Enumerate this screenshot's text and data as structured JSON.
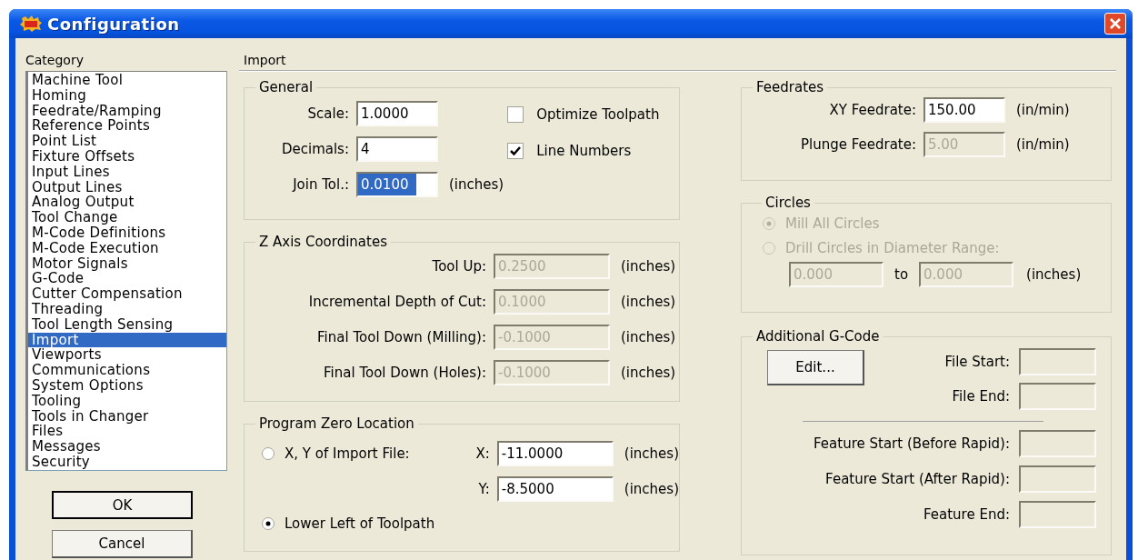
{
  "window": {
    "title": "Configuration"
  },
  "category": {
    "label": "Category",
    "items": [
      {
        "label": "Machine Tool",
        "selected": false
      },
      {
        "label": "Homing",
        "selected": false
      },
      {
        "label": "Feedrate/Ramping",
        "selected": false
      },
      {
        "label": "Reference Points",
        "selected": false
      },
      {
        "label": "Point List",
        "selected": false
      },
      {
        "label": "Fixture Offsets",
        "selected": false
      },
      {
        "label": "Input Lines",
        "selected": false
      },
      {
        "label": "Output Lines",
        "selected": false
      },
      {
        "label": "Analog Output",
        "selected": false
      },
      {
        "label": "Tool Change",
        "selected": false
      },
      {
        "label": "M-Code Definitions",
        "selected": false
      },
      {
        "label": "M-Code Execution",
        "selected": false
      },
      {
        "label": "Motor Signals",
        "selected": false
      },
      {
        "label": "G-Code",
        "selected": false
      },
      {
        "label": "Cutter Compensation",
        "selected": false
      },
      {
        "label": "Threading",
        "selected": false
      },
      {
        "label": "Tool Length Sensing",
        "selected": false
      },
      {
        "label": "Import",
        "selected": true
      },
      {
        "label": "Viewports",
        "selected": false
      },
      {
        "label": "Communications",
        "selected": false
      },
      {
        "label": "System Options",
        "selected": false
      },
      {
        "label": "Tooling",
        "selected": false
      },
      {
        "label": "Tools in Changer",
        "selected": false
      },
      {
        "label": "Files",
        "selected": false
      },
      {
        "label": "Messages",
        "selected": false
      },
      {
        "label": "Security",
        "selected": false
      }
    ]
  },
  "buttons": [
    {
      "label": "OK",
      "default": true
    },
    {
      "label": "Cancel",
      "default": false
    }
  ],
  "page": {
    "title": "Import"
  },
  "general": {
    "title": "General",
    "fields": [
      {
        "label": "Scale:",
        "value": "1.0000",
        "disabled": false,
        "text_selected": false
      },
      {
        "label": "Decimals:",
        "value": "4",
        "disabled": false,
        "text_selected": false
      },
      {
        "label": "Join Tol.:",
        "value": "0.0100",
        "unit": "(inches)",
        "disabled": false,
        "text_selected": true
      }
    ],
    "checkboxes": [
      {
        "label": "Optimize Toolpath",
        "checked": false
      },
      {
        "label": "Line Numbers",
        "checked": true
      }
    ]
  },
  "z_axis": {
    "title": "Z Axis Coordinates",
    "fields": [
      {
        "label": "Tool Up:",
        "value": "0.2500",
        "unit": "(inches)",
        "disabled": true
      },
      {
        "label": "Incremental Depth of Cut:",
        "value": "0.1000",
        "unit": "(inches)",
        "disabled": true
      },
      {
        "label": "Final Tool Down (Milling):",
        "value": "-0.1000",
        "unit": "(inches)",
        "disabled": true
      },
      {
        "label": "Final Tool Down (Holes):",
        "value": "-0.1000",
        "unit": "(inches)",
        "disabled": true
      }
    ]
  },
  "program_zero": {
    "title": "Program Zero Location",
    "options": [
      {
        "label": "X, Y of Import File:",
        "selected": false
      },
      {
        "label": "Lower Left of Toolpath",
        "selected": true
      }
    ],
    "fields": [
      {
        "label": "X:",
        "value": "-11.0000",
        "unit": "(inches)",
        "disabled": false
      },
      {
        "label": "Y:",
        "value": "-8.5000",
        "unit": "(inches)",
        "disabled": false
      }
    ]
  },
  "feedrates": {
    "title": "Feedrates",
    "fields": [
      {
        "label": "XY Feedrate:",
        "value": "150.00",
        "unit": "(in/min)",
        "disabled": false
      },
      {
        "label": "Plunge Feedrate:",
        "value": "5.00",
        "unit": "(in/min)",
        "disabled": true
      }
    ]
  },
  "circles": {
    "title": "Circles",
    "options": [
      {
        "label": "Mill All Circles",
        "selected": true,
        "disabled": true
      },
      {
        "label": "Drill Circles in Diameter Range:",
        "selected": false,
        "disabled": true
      }
    ],
    "range": {
      "from": {
        "value": "0.000",
        "disabled": true
      },
      "separator": "to",
      "to": {
        "value": "0.000",
        "disabled": true
      },
      "unit": "(inches)"
    }
  },
  "additional_gcode": {
    "title": "Additional G-Code",
    "edit_button": {
      "label": "Edit..."
    },
    "file_fields": [
      {
        "label": "File Start:",
        "disabled": true
      },
      {
        "label": "File End:",
        "disabled": true
      }
    ],
    "feature_fields": [
      {
        "label": "Feature Start (Before Rapid):",
        "disabled": true
      },
      {
        "label": "Feature Start (After Rapid):",
        "disabled": true
      },
      {
        "label": "Feature End:",
        "disabled": true
      }
    ]
  }
}
